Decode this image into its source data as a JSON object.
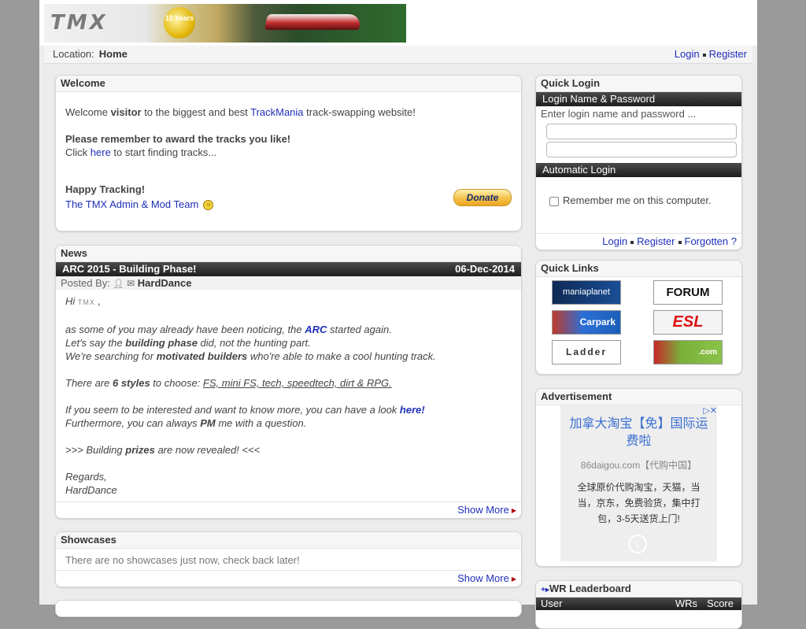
{
  "header": {
    "banner_logo_text": "TMX",
    "banner_medal_text": "10 Years"
  },
  "location": {
    "label": "Location:",
    "current": "Home",
    "login_link": "Login",
    "register_link": "Register"
  },
  "welcome": {
    "title": "Welcome",
    "line1_pre": "Welcome ",
    "line1_bold": "visitor",
    "line1_mid": " to the biggest and best ",
    "line1_link": "TrackMania",
    "line1_post": " track-swapping website!",
    "line2_bold": "Please remember to award the tracks you like!",
    "line3_pre": "Click ",
    "line3_link": "here",
    "line3_post": " to start finding tracks...",
    "sign_bold": "Happy Tracking!",
    "sign_link": "The TMX Admin & Mod Team",
    "donate_label": "Donate"
  },
  "news": {
    "title": "News",
    "headline": "ARC 2015 - Building Phase!",
    "date": "06-Dec-2014",
    "posted_by_label": "Posted By:",
    "author": "HardDance",
    "greeting_pre": "Hi ",
    "greeting_post": " ,",
    "p1_pre": "as some of you may already have been noticing, the ",
    "p1_link": "ARC",
    "p1_post": " started again.",
    "p2_pre": "Let's say the ",
    "p2_bold": "building phase",
    "p2_post": " did, not the hunting part.",
    "p3_pre": "We're searching for ",
    "p3_bold": "motivated builders",
    "p3_post": " who're able to make a cool hunting track.",
    "p4_pre": "There are ",
    "p4_bold": "6 styles",
    "p4_mid": " to choose: ",
    "p4_under": "FS, mini FS, tech, speedtech, dirt & RPG.",
    "p5_pre": "If you seem to be interested and want to know more, you can have a look ",
    "p5_link": "here!",
    "p6_pre": "Furthermore, you can always ",
    "p6_bold": "PM",
    "p6_post": " me with a question.",
    "p7_pre": ">>> Building ",
    "p7_bold": "prizes",
    "p7_post": " are now revealed! <<<",
    "regards": "Regards,",
    "signature": "HardDance",
    "show_more": "Show More"
  },
  "showcases": {
    "title": "Showcases",
    "message": "There are no showcases just now, check back later!",
    "show_more": "Show More"
  },
  "quick_login": {
    "title": "Quick Login",
    "section1": "Login Name & Password",
    "hint": "Enter login name and password ...",
    "section2": "Automatic Login",
    "remember": "Remember me on this computer.",
    "login_link": "Login",
    "register_link": "Register",
    "forgotten_link": "Forgotten ?"
  },
  "quick_links": {
    "title": "Quick Links",
    "items": [
      "maniaplanet",
      "FORUM",
      "Carpark",
      "ESL",
      "Ladder",
      ".com"
    ]
  },
  "advertisement": {
    "title": "Advertisement",
    "headline": "加拿大淘宝【免】国际运费啦",
    "source": "86daigou.com【代购中国】",
    "body": "全球原价代购淘宝，天猫，当当，京东，免费验货，集中打包，3-5天送货上门!"
  },
  "wr_leaderboard": {
    "title": "WR Leaderboard",
    "col_user": "User",
    "col_wrs": "WRs",
    "col_score": "Score"
  },
  "colors": {
    "link": "#1f2fb8",
    "page_bg": "#ececec",
    "outer_bg": "#9a9a9a",
    "dark_bar": "#2a2a2a"
  }
}
